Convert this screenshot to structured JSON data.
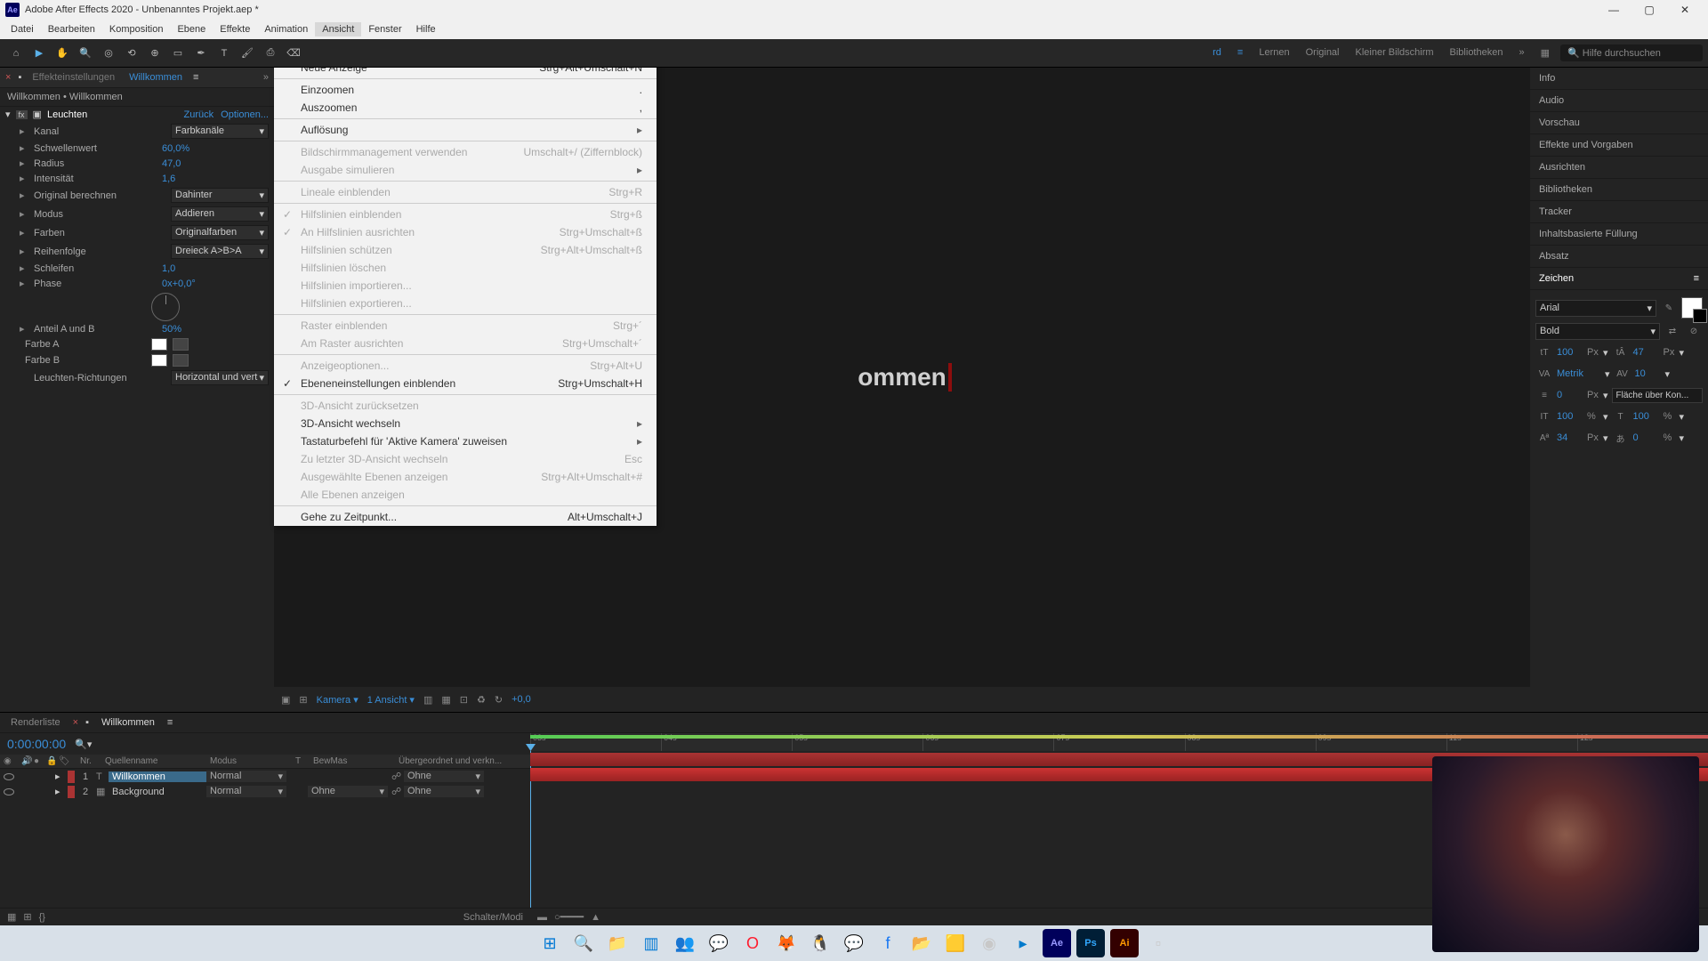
{
  "title": "Adobe After Effects 2020 - Unbenanntes Projekt.aep *",
  "menubar": [
    "Datei",
    "Bearbeiten",
    "Komposition",
    "Ebene",
    "Effekte",
    "Animation",
    "Ansicht",
    "Fenster",
    "Hilfe"
  ],
  "menubar_active_index": 6,
  "toolbar_tabs": [
    "Lernen",
    "Original",
    "Kleiner Bildschirm",
    "Bibliotheken"
  ],
  "search_placeholder": "Hilfe durchsuchen",
  "panel_tabs": {
    "left": "Effekteinstellungen",
    "active": "Willkommen"
  },
  "panel_sub": "Willkommen • Willkommen",
  "effect": {
    "name": "Leuchten",
    "back": "Zurück",
    "options": "Optionen...",
    "rows": [
      {
        "name": "Kanal",
        "dd": "Farbkanäle"
      },
      {
        "name": "Schwellenwert",
        "val": "60,0",
        "unit": "%"
      },
      {
        "name": "Radius",
        "val": "47,0"
      },
      {
        "name": "Intensität",
        "val": "1,6"
      },
      {
        "name": "Original berechnen",
        "dd": "Dahinter"
      },
      {
        "name": "Modus",
        "dd": "Addieren"
      },
      {
        "name": "Farben",
        "dd": "Originalfarben"
      },
      {
        "name": "Reihenfolge",
        "dd": "Dreieck A>B>A"
      },
      {
        "name": "Schleifen",
        "val": "1,0"
      },
      {
        "name": "Phase",
        "val": "0x+0,0°"
      }
    ],
    "anteil": {
      "name": "Anteil A und B",
      "val": "50",
      "unit": "%"
    },
    "farbe_a": "Farbe A",
    "farbe_b": "Farbe B",
    "richtungen": {
      "name": "Leuchten-Richtungen",
      "dd": "Horizontal und vert"
    }
  },
  "dropdown": [
    {
      "label": "Neue Anzeige",
      "short": "Strg+Alt+Umschalt+N"
    },
    {
      "sep": true
    },
    {
      "label": "Einzoomen",
      "short": "."
    },
    {
      "label": "Auszoomen",
      "short": ","
    },
    {
      "sep": true
    },
    {
      "label": "Auflösung",
      "arrow": true
    },
    {
      "sep": true
    },
    {
      "label": "Bildschirmmanagement verwenden",
      "short": "Umschalt+/ (Ziffernblock)",
      "disabled": true
    },
    {
      "label": "Ausgabe simulieren",
      "arrow": true,
      "disabled": true
    },
    {
      "sep": true
    },
    {
      "label": "Lineale einblenden",
      "short": "Strg+R",
      "disabled": true
    },
    {
      "sep": true
    },
    {
      "label": "Hilfslinien einblenden",
      "short": "Strg+ß",
      "disabled": true,
      "check": true
    },
    {
      "label": "An Hilfslinien ausrichten",
      "short": "Strg+Umschalt+ß",
      "disabled": true,
      "check": true
    },
    {
      "label": "Hilfslinien schützen",
      "short": "Strg+Alt+Umschalt+ß",
      "disabled": true
    },
    {
      "label": "Hilfslinien löschen",
      "disabled": true
    },
    {
      "label": "Hilfslinien importieren...",
      "disabled": true
    },
    {
      "label": "Hilfslinien exportieren...",
      "disabled": true
    },
    {
      "sep": true
    },
    {
      "label": "Raster einblenden",
      "short": "Strg+´",
      "disabled": true
    },
    {
      "label": "Am Raster ausrichten",
      "short": "Strg+Umschalt+´",
      "disabled": true
    },
    {
      "sep": true
    },
    {
      "label": "Anzeigeoptionen...",
      "short": "Strg+Alt+U",
      "disabled": true
    },
    {
      "label": "Ebeneneinstellungen einblenden",
      "short": "Strg+Umschalt+H",
      "check": true
    },
    {
      "sep": true
    },
    {
      "label": "3D-Ansicht zurücksetzen",
      "disabled": true
    },
    {
      "label": "3D-Ansicht wechseln",
      "arrow": true
    },
    {
      "label": "Tastaturbefehl für 'Aktive Kamera' zuweisen",
      "arrow": true
    },
    {
      "label": "Zu letzter 3D-Ansicht wechseln",
      "short": "Esc",
      "disabled": true
    },
    {
      "label": "Ausgewählte Ebenen anzeigen",
      "short": "Strg+Alt+Umschalt+#",
      "disabled": true
    },
    {
      "label": "Alle Ebenen anzeigen",
      "disabled": true
    },
    {
      "sep": true
    },
    {
      "label": "Gehe zu Zeitpunkt...",
      "short": "Alt+Umschalt+J"
    }
  ],
  "comp_text": "ommen",
  "viewer_footer": {
    "camera": "Kamera",
    "views": "1 Ansicht",
    "exp": "+0,0"
  },
  "right_panels": [
    "Info",
    "Audio",
    "Vorschau",
    "Effekte und Vorgaben",
    "Ausrichten",
    "Bibliotheken",
    "Tracker",
    "Inhaltsbasierte Füllung",
    "Absatz"
  ],
  "char": {
    "title": "Zeichen",
    "font": "Arial",
    "weight": "Bold",
    "size": "100",
    "size_unit": "Px",
    "leading": "47",
    "leading_unit": "Px",
    "metrics": "Metrik",
    "tracking": "10",
    "stroke": "0",
    "stroke_unit": "Px",
    "fill_opt": "Fläche über Kon...",
    "vscale": "100",
    "vscale_unit": "%",
    "hscale": "100",
    "hscale_unit": "%",
    "baseline": "34",
    "baseline_unit": "Px",
    "tsume": "0",
    "tsume_unit": "%"
  },
  "timeline": {
    "tabs": {
      "render": "Renderliste",
      "comp": "Willkommen"
    },
    "timecode": "0:00:00:00",
    "cols": [
      "Nr.",
      "Quellenname",
      "Modus",
      "T",
      "BewMas",
      "Übergeordnet und verkn..."
    ],
    "rows": [
      {
        "num": "1",
        "name": "Willkommen",
        "mode": "Normal",
        "parent": "Ohne",
        "selected": true,
        "type": "T"
      },
      {
        "num": "2",
        "name": "Background",
        "mode": "Normal",
        "track": "Ohne",
        "parent": "Ohne"
      }
    ],
    "ticks": [
      "03s",
      "04s",
      "05s",
      "06s",
      "07s",
      "08s",
      "09s",
      "11s",
      "12s"
    ],
    "footer": "Schalter/Modi"
  }
}
